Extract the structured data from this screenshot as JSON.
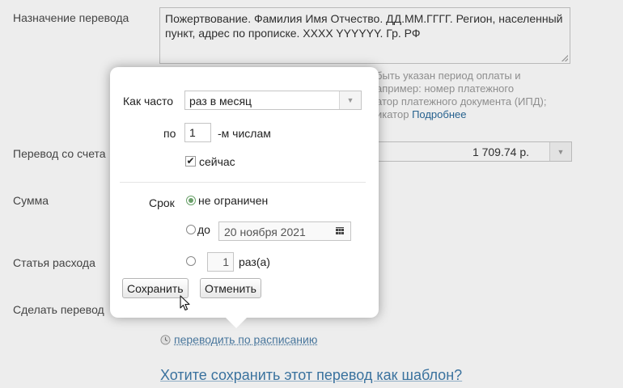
{
  "form": {
    "purpose_label": "Назначение перевода",
    "purpose_value": "Пожертвование. Фамилия Имя Отчество. ДД.ММ.ГГГГ. Регион, населенный пункт, адрес по прописке. XXXX YYYYYY. Гр. РФ",
    "hint_text": "быть указан период оплаты и\nапример: номер платежного\nатор платежного документа (ИПД);\nикатор ",
    "hint_link": "Подробнее",
    "from_account_label": "Перевод со счета",
    "from_account_amount": "1 709.74 р.",
    "sum_label": "Сумма",
    "expense_label": "Статья расхода",
    "make_transfer_label": "Сделать перевод",
    "schedule_link": "переводить по расписанию",
    "template_link": "Хотите сохранить этот перевод как шаблон?"
  },
  "popup": {
    "frequency_label": "Как часто",
    "frequency_value": "раз в месяц",
    "day_prefix": "по",
    "day_value": "1",
    "day_suffix": "-м числам",
    "now_label": "сейчас",
    "now_checked": true,
    "term_label": "Срок",
    "term_unlimited": "не ограничен",
    "term_until": "до",
    "term_until_date": "20 ноября 2021",
    "term_times_value": "1",
    "term_times_suffix": "раз(а)",
    "save_button": "Сохранить",
    "cancel_button": "Отменить"
  },
  "colors": {
    "link": "#3f7bab",
    "radio_active": "#6aa06a"
  },
  "icons": [
    "clock-icon",
    "dropdown-arrow-icon",
    "calendar-icon",
    "checkmark-icon",
    "mouse-cursor-icon",
    "resize-grip-icon"
  ]
}
